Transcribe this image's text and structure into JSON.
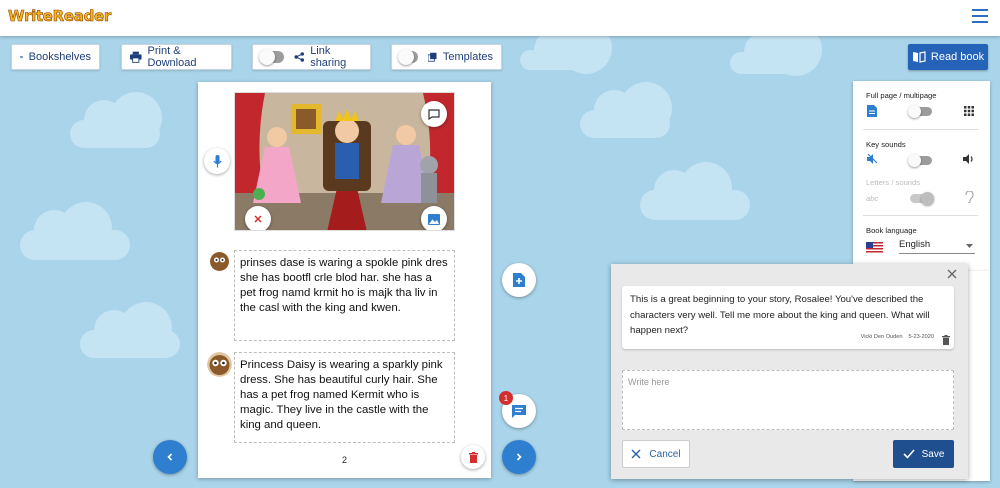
{
  "app": {
    "logo_text": "WriteReader",
    "colors": {
      "brand": "#f7b81c",
      "accent": "#2563b8",
      "background": "#a9d4ea"
    }
  },
  "toolbar": {
    "bookshelves": "Bookshelves",
    "print_download": "Print & Download",
    "link_sharing": "Link sharing",
    "templates": "Templates",
    "read_book": "Read book"
  },
  "page": {
    "child_text": "prinses dase is waring a spokle pink dres she has bootfl crle blod har. she has a pet frog namd krmit ho is majk tha liv in the casl with the king and kwen.",
    "adult_text": "Princess Daisy is wearing a sparkly pink dress. She has beautiful curly hair. She has a pet frog named Kermit who is magic. They live in the castle with the king and queen.",
    "page_number": "2"
  },
  "comments": {
    "badge_count": "1"
  },
  "settings": {
    "full_page_label": "Full page / multipage",
    "key_sounds_label": "Key sounds",
    "letters_sounds_label": "Letters / sounds",
    "abc_glyph": "abc",
    "book_language_label": "Book language",
    "language_value": "English"
  },
  "comment_panel": {
    "comment_text": "This is a great beginning to your story, Rosalee! You've described the characters very well. Tell me more about the king and queen. What will happen next?",
    "author": "Vicki Den Ouden",
    "date": "5-23-2020",
    "placeholder": "Write here",
    "cancel_label": "Cancel",
    "save_label": "Save"
  }
}
